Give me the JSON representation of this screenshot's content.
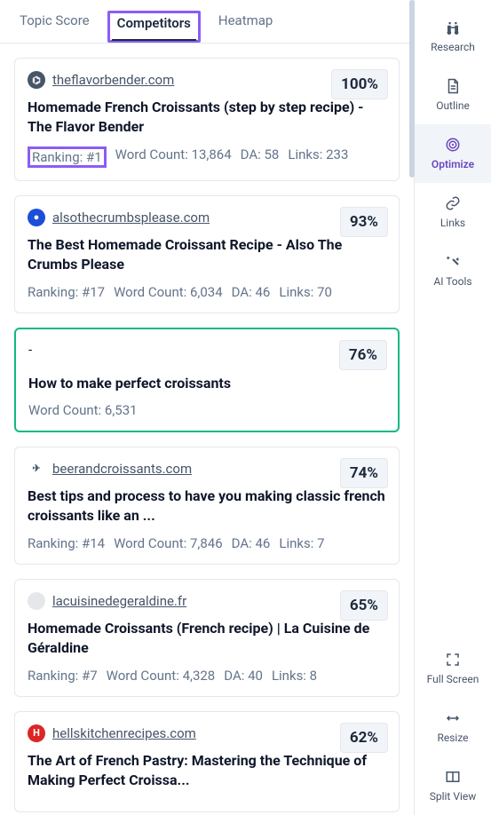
{
  "tabs": {
    "topic_score": "Topic Score",
    "competitors": "Competitors",
    "heatmap": "Heatmap"
  },
  "competitors": [
    {
      "favicon_class": "fav-flask",
      "favicon_glyph": "⌬",
      "domain": "theflavorbender.com",
      "score": "100%",
      "title": "Homemade French Croissants (step by step recipe) - The Flavor Bender",
      "ranking_label": "Ranking: #1",
      "ranking_highlight": true,
      "word_count_label": "Word Count: 13,864",
      "da_label": "DA: 58",
      "links_label": "Links: 233",
      "selected": false
    },
    {
      "favicon_class": "fav-blue",
      "favicon_glyph": "●",
      "domain": "alsothecrumbsplease.com",
      "score": "93%",
      "title": "The Best Homemade Croissant Recipe - Also The Crumbs Please",
      "ranking_label": "Ranking: #17",
      "ranking_highlight": false,
      "word_count_label": "Word Count: 6,034",
      "da_label": "DA: 46",
      "links_label": "Links: 70",
      "selected": false
    },
    {
      "favicon_class": "",
      "favicon_glyph": "",
      "domain": "-",
      "score": "76%",
      "title": "How to make perfect croissants",
      "ranking_label": "",
      "ranking_highlight": false,
      "word_count_label": "Word Count: 6,531",
      "da_label": "",
      "links_label": "",
      "selected": true
    },
    {
      "favicon_class": "fav-plane",
      "favicon_glyph": "✈",
      "domain": "beerandcroissants.com",
      "score": "74%",
      "title": "Best tips and process to have you making classic french croissants like an ...",
      "ranking_label": "Ranking: #14",
      "ranking_highlight": false,
      "word_count_label": "Word Count: 7,846",
      "da_label": "DA: 46",
      "links_label": "Links: 7",
      "selected": false
    },
    {
      "favicon_class": "fav-grey",
      "favicon_glyph": " ",
      "domain": "lacuisinedegeraldine.fr",
      "score": "65%",
      "title": "Homemade Croissants (French recipe) | La Cuisine de Géraldine",
      "ranking_label": "Ranking: #7",
      "ranking_highlight": false,
      "word_count_label": "Word Count: 4,328",
      "da_label": "DA: 40",
      "links_label": "Links: 8",
      "selected": false
    },
    {
      "favicon_class": "fav-red",
      "favicon_glyph": "H",
      "domain": "hellskitchenrecipes.com",
      "score": "62%",
      "title": "The Art of French Pastry: Mastering the Technique of Making Perfect Croissa...",
      "ranking_label": "",
      "ranking_highlight": false,
      "word_count_label": "",
      "da_label": "",
      "links_label": "",
      "selected": false
    }
  ],
  "sidebar": {
    "research": "Research",
    "outline": "Outline",
    "optimize": "Optimize",
    "links": "Links",
    "ai_tools": "AI Tools",
    "full_screen": "Full Screen",
    "resize": "Resize",
    "split_view": "Split View"
  }
}
